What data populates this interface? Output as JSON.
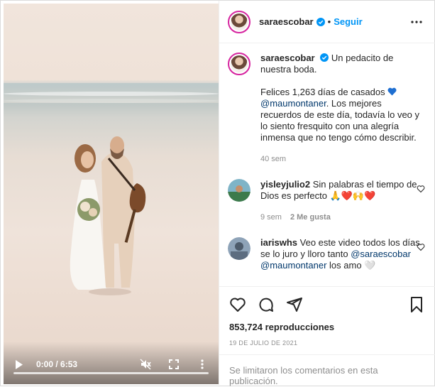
{
  "video": {
    "time": "0:00 / 6:53",
    "progress": 0
  },
  "header": {
    "username": "saraescobar",
    "dot": "•",
    "follow_label": "Seguir"
  },
  "caption": {
    "username": "saraescobar",
    "text1": "Un pedacito de nuestra boda.",
    "text2": "Felices 1,263 días de casados",
    "mention": "@maumontaner",
    "text3": ". Los mejores recuerdos de este día, todavía lo veo y lo siento fresquito con una alegría inmensa que no tengo cómo describir.",
    "time": "40 sem"
  },
  "comments": [
    {
      "username": "yisleyjulio2",
      "text": "Sin palabras el tiempo de Dios es perfecto 🙏❤️🙌❤️",
      "time": "9 sem",
      "likes": "2 Me gusta"
    },
    {
      "username": "iariswhs",
      "text": "Veo este video todos los días se lo juro y lloro tanto",
      "mention1": "@saraescobar",
      "mention2": "@maumontaner",
      "tail": "los amo 🤍"
    }
  ],
  "stats": {
    "views": "853,724 reproducciones",
    "date": "19 DE JULIO DE 2021"
  },
  "footer": {
    "limited_text": "Se limitaron los comentarios en esta publicación."
  },
  "colors": {
    "accent": "#0095f6",
    "mention": "#00376b",
    "muted": "#8e8e8e"
  }
}
